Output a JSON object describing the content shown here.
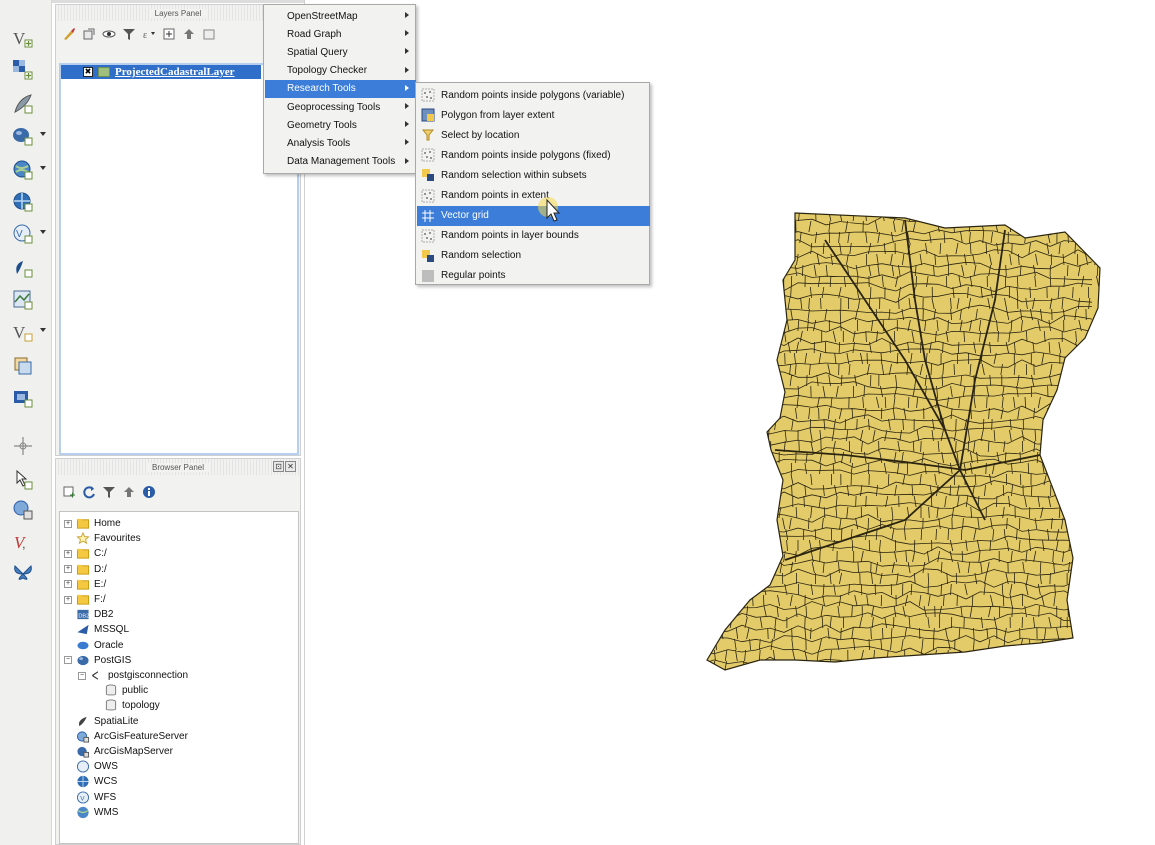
{
  "layers_panel": {
    "title": "Layers Panel",
    "layer": {
      "name": "ProjectedCadastralLayer",
      "checked_mark": "✖"
    }
  },
  "browser_panel": {
    "title": "Browser Panel",
    "float_glyph": "⊡",
    "close_glyph": "✕",
    "items": [
      {
        "label": "Home",
        "icon": "folder-icon",
        "expandable": true
      },
      {
        "label": "Favourites",
        "icon": "star-icon",
        "expandable": false
      },
      {
        "label": "C:/",
        "icon": "folder-icon",
        "expandable": true
      },
      {
        "label": "D:/",
        "icon": "folder-icon",
        "expandable": true
      },
      {
        "label": "E:/",
        "icon": "folder-icon",
        "expandable": true
      },
      {
        "label": "F:/",
        "icon": "folder-icon",
        "expandable": true
      },
      {
        "label": "DB2",
        "icon": "db2-icon",
        "expandable": false
      },
      {
        "label": "MSSQL",
        "icon": "mssql-icon",
        "expandable": false
      },
      {
        "label": "Oracle",
        "icon": "oracle-icon",
        "expandable": false
      },
      {
        "label": "PostGIS",
        "icon": "postgis-icon",
        "expandable": true,
        "expanded": true
      },
      {
        "label": "postgisconnection",
        "icon": "connection-icon",
        "expandable": true,
        "expanded": true
      },
      {
        "label": "public",
        "icon": "schema-icon",
        "expandable": false
      },
      {
        "label": "topology",
        "icon": "schema-icon",
        "expandable": false
      },
      {
        "label": "SpatiaLite",
        "icon": "spatialite-icon",
        "expandable": false
      },
      {
        "label": "ArcGisFeatureServer",
        "icon": "arcgis-feature-icon",
        "expandable": false
      },
      {
        "label": "ArcGisMapServer",
        "icon": "arcgis-map-icon",
        "expandable": false
      },
      {
        "label": "OWS",
        "icon": "ows-icon",
        "expandable": false
      },
      {
        "label": "WCS",
        "icon": "wcs-icon",
        "expandable": false
      },
      {
        "label": "WFS",
        "icon": "wfs-icon",
        "expandable": false
      },
      {
        "label": "WMS",
        "icon": "wms-icon",
        "expandable": false
      }
    ]
  },
  "processing_menu": {
    "items": [
      {
        "label": "OpenStreetMap",
        "has_submenu": true
      },
      {
        "label": "Road Graph",
        "has_submenu": true
      },
      {
        "label": "Spatial Query",
        "has_submenu": true
      },
      {
        "label": "Topology Checker",
        "has_submenu": true
      },
      {
        "label": "Research Tools",
        "has_submenu": true,
        "active": true
      },
      {
        "label": "Geoprocessing Tools",
        "has_submenu": true
      },
      {
        "label": "Geometry Tools",
        "has_submenu": true
      },
      {
        "label": "Analysis Tools",
        "has_submenu": true
      },
      {
        "label": "Data Management Tools",
        "has_submenu": true
      }
    ]
  },
  "research_submenu": {
    "items": [
      {
        "label": "Random points inside polygons (variable)",
        "icon": "random-points-icon"
      },
      {
        "label": "Polygon from layer extent",
        "icon": "polygon-extent-icon"
      },
      {
        "label": "Select by location",
        "icon": "select-location-icon"
      },
      {
        "label": "Random points inside polygons (fixed)",
        "icon": "random-points-icon"
      },
      {
        "label": "Random selection within subsets",
        "icon": "random-selection-icon"
      },
      {
        "label": "Random points in extent",
        "icon": "random-points-icon"
      },
      {
        "label": "Vector grid",
        "icon": "vector-grid-icon",
        "active": true
      },
      {
        "label": "Random points in layer bounds",
        "icon": "random-points-icon"
      },
      {
        "label": "Random selection",
        "icon": "random-selection-icon"
      },
      {
        "label": "Regular points",
        "icon": "regular-points-icon"
      }
    ]
  },
  "map": {
    "fill_color": "#e3cb6a",
    "line_color": "#2a2410"
  },
  "colors": {
    "selection": "#3b7dd8",
    "layer_selection": "#2f6fc9"
  }
}
